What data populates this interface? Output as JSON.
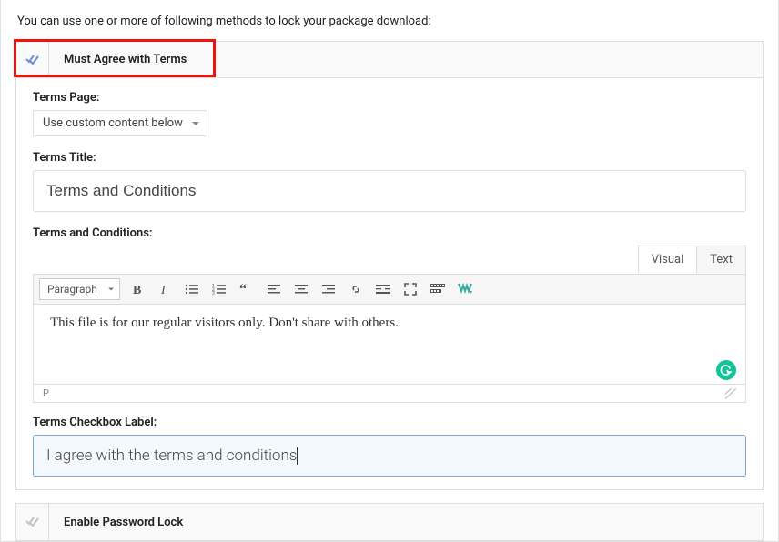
{
  "intro": "You can use one or more of following methods to lock your package download:",
  "section1": {
    "title": "Must Agree with Terms",
    "termsPageLabel": "Terms Page:",
    "termsPageSelected": "Use custom content below",
    "termsTitleLabel": "Terms Title:",
    "termsTitleValue": "Terms and Conditions",
    "termsContentLabel": "Terms and Conditions:",
    "editor": {
      "tabs": {
        "visual": "Visual",
        "text": "Text"
      },
      "paragraphSelector": "Paragraph",
      "content": "This file is for our regular visitors only. Don't share with others.",
      "statusPath": "P"
    },
    "checkboxLabel": "Terms Checkbox Label:",
    "checkboxValue": "I agree with the terms and conditions"
  },
  "section2": {
    "title": "Enable Password Lock"
  }
}
